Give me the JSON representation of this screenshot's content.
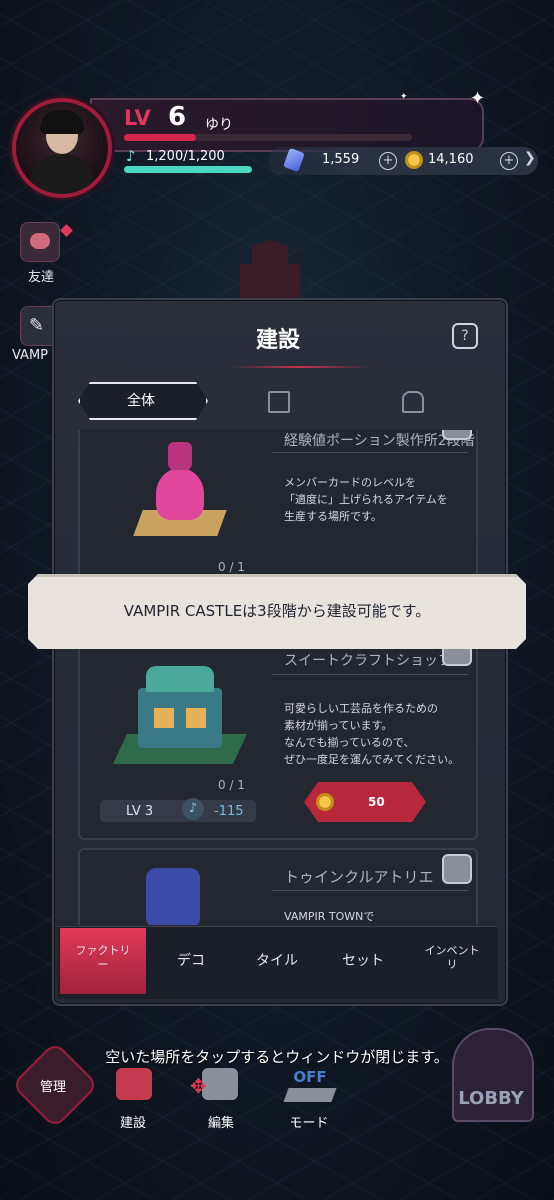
{
  "hud": {
    "level_label": "LV",
    "level": "6",
    "username": "ゆり",
    "stamina": "1,200/1,200",
    "xp_fraction": 0.25,
    "stamina_fraction": 1.0,
    "gems": "1,559",
    "coins": "14,160"
  },
  "side": {
    "friends_label": "友達",
    "vampir_label": "VAMP"
  },
  "panel": {
    "title": "建設",
    "help_label": "?",
    "tabs": [
      {
        "label": "全体",
        "selected": true
      },
      {
        "label": "",
        "icon": "building-icon"
      },
      {
        "label": "",
        "icon": "house-icon"
      }
    ]
  },
  "items": [
    {
      "name": "経験値ポーション製作所2段階",
      "desc_lines": [
        "メンバーカードのレベルを",
        "「適度に」上げられるアイテムを",
        "生産する場所です。"
      ],
      "count": "0 / 1"
    },
    {
      "name": "スイートクラフトショップ",
      "desc_lines": [
        "可愛らしい工芸品を作るための",
        "素材が揃っています。",
        "なんでも揃っているので、",
        "ぜひ一度足を運んでみてください。"
      ],
      "count": "0 / 1",
      "level": "LV 3",
      "note_value": "-115",
      "cost": "50"
    },
    {
      "name": "トゥインクルアトリエ",
      "desc_lines": [
        "VAMPIR TOWNで"
      ]
    }
  ],
  "toast": "VAMPIR CASTLEは3段階から建設可能です。",
  "bottom_tabs": [
    {
      "label": "ファクトリ\nー",
      "selected": true
    },
    {
      "label": "デコ"
    },
    {
      "label": "タイル"
    },
    {
      "label": "セット"
    },
    {
      "label": "インベント\nリ"
    }
  ],
  "footer": {
    "hint": "空いた場所をタップするとウィンドウが閉じます。",
    "manage_label": "管理",
    "build_label": "建設",
    "edit_label": "編集",
    "mode_label": "モード",
    "mode_state": "OFF",
    "lobby_label": "LOBBY"
  },
  "colors": {
    "accent": "#d4264a",
    "stamina": "#4bd8c2",
    "toast_bg": "#e8e3dc"
  }
}
